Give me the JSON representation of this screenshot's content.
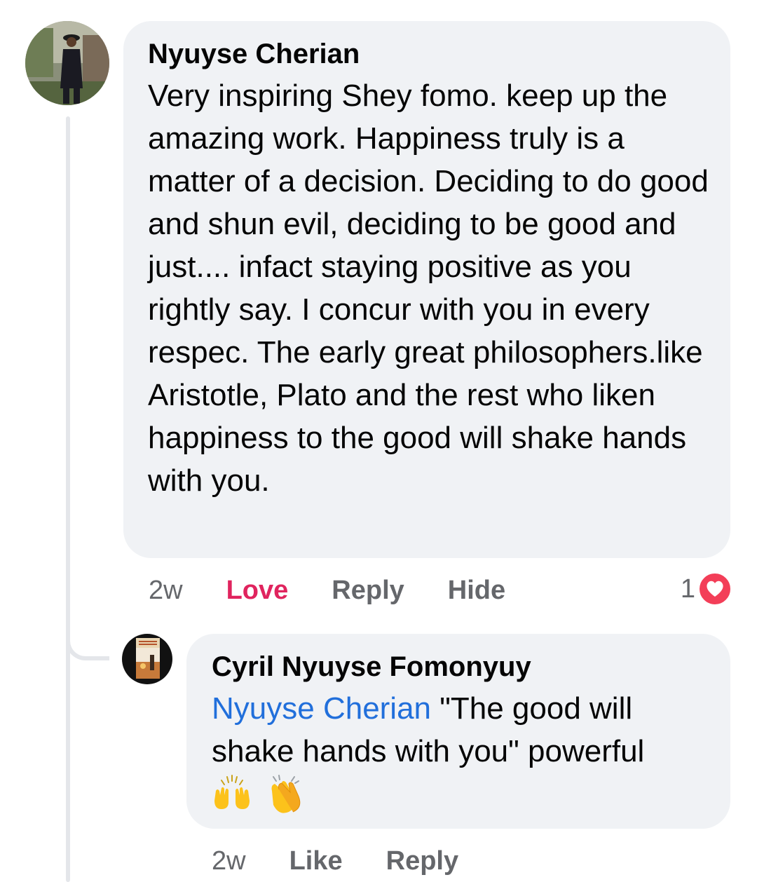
{
  "comment": {
    "author": "Nyuyse Cherian",
    "avatar_icon": "profile-photo",
    "text": "Very inspiring Shey fomo. keep up the amazing work. Happiness truly is a matter of a decision. Deciding to do good and shun evil, deciding to be good and just.... infact staying positive as you rightly say. I concur with you in every respec. The early great philosophers.like Aristotle, Plato and the rest who liken happiness to the good will shake hands with you.",
    "time": "2w",
    "love_label": "Love",
    "reply_label": "Reply",
    "hide_label": "Hide",
    "reaction_count": "1",
    "reaction_icon": "heart-icon"
  },
  "reply": {
    "author": "Cyril Nyuyse Fomonyuy",
    "avatar_icon": "book-cover-photo",
    "mention": "Nyuyse Cherian",
    "text": " \"The good will shake hands with you\" powerful",
    "emojis": [
      "raising-hands-emoji",
      "clapping-hands-emoji"
    ],
    "time": "2w",
    "like_label": "Like",
    "reply_label": "Reply"
  },
  "colors": {
    "bubble": "#f0f2f5",
    "text": "#050505",
    "muted": "#65676b",
    "love": "#e0245e",
    "mention": "#216fdb",
    "thread_line": "#e4e6ea"
  }
}
